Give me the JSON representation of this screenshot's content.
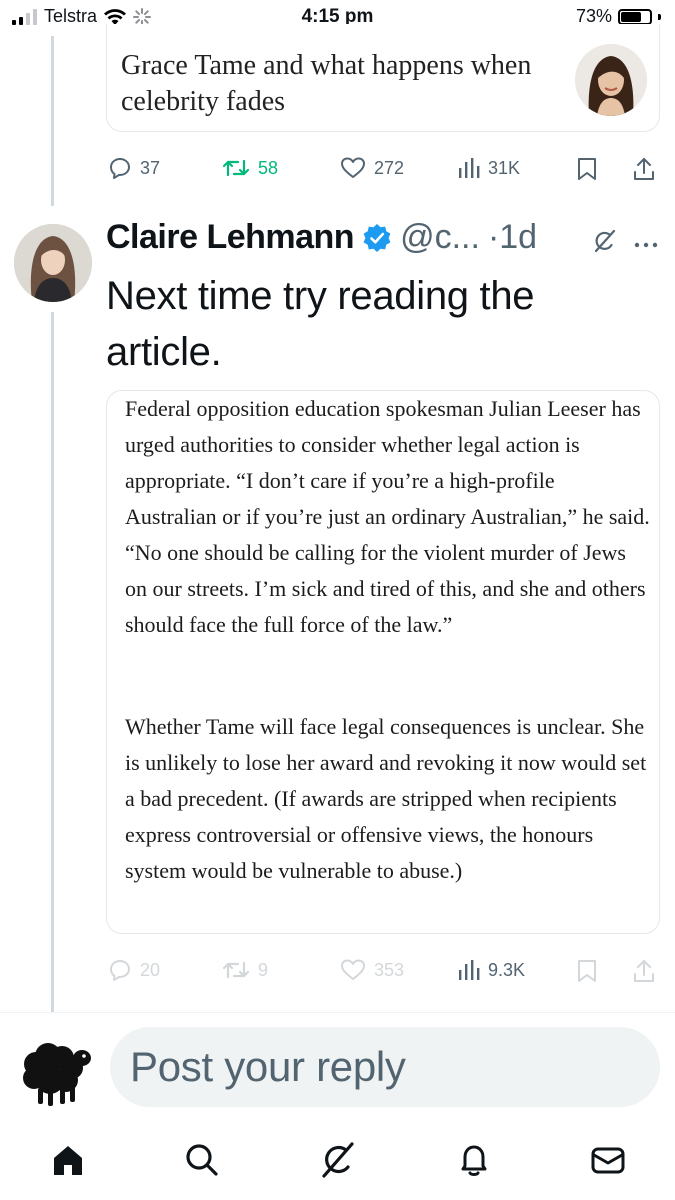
{
  "status_bar": {
    "carrier": "Telstra",
    "time": "4:15 pm",
    "battery": "73%",
    "battery_level": 0.73
  },
  "quoted_card": {
    "headline": "Grace Tame and what happens when celebrity fades"
  },
  "top_actions": {
    "replies": "37",
    "reposts": "58",
    "likes": "272",
    "views": "31K"
  },
  "tweet": {
    "author_name": "Claire Lehmann",
    "handle": "@c...",
    "time": "·1d",
    "text": "Next time try reading the article.",
    "excerpt": {
      "paragraph_1": "Federal opposition education spokesman Julian Leeser has urged authorities to consider whether legal action is appropriate. “I don’t care if you’re a high-profile Australian or if you’re just an ordinary Australian,” he said. “No one should be calling for the violent murder of Jews on our streets. I’m sick and tired of this, and she and others should face the full force of the law.”",
      "paragraph_2": "Whether Tame will face legal consequences is unclear. She is unlikely to lose her award and revoking it now would set a bad precedent. (If awards are stripped when recipients express controversial or offensive views, the honours system would be vulnerable to abuse.)"
    },
    "actions": {
      "replies": "20",
      "reposts": "9",
      "likes": "353",
      "views": "9.3K"
    }
  },
  "composer": {
    "placeholder": "Post your reply"
  },
  "colors": {
    "text": "#0f1419",
    "muted": "#536471",
    "repost_green": "#00ba7c",
    "verified_blue": "#1d9bf0"
  }
}
